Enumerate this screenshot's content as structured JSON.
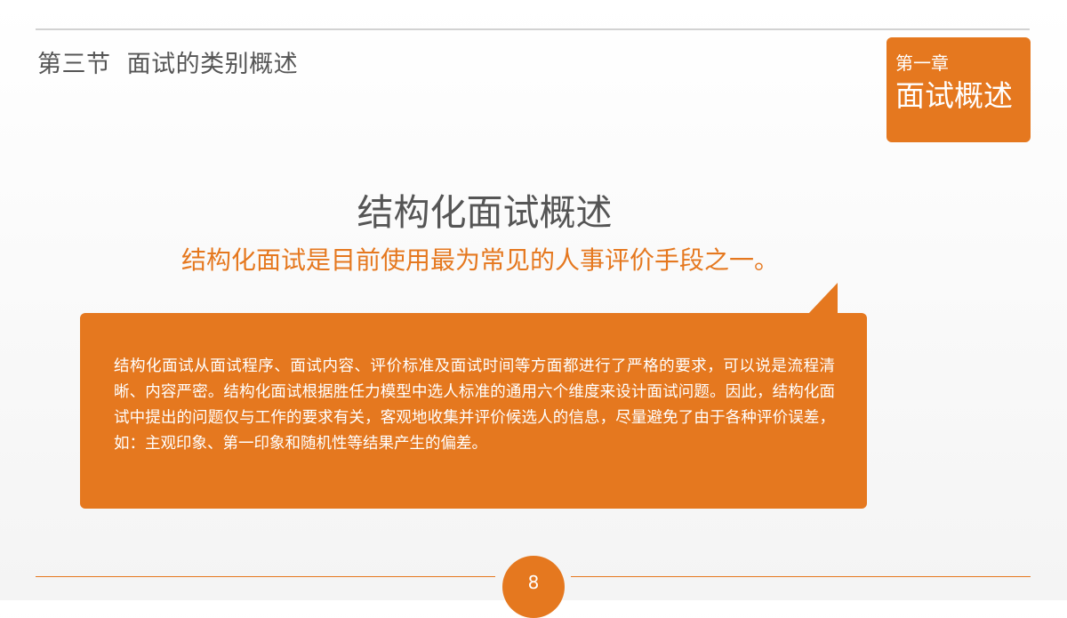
{
  "header": {
    "section_title": "第三节  面试的类别概述"
  },
  "chapter": {
    "label": "第一章",
    "name": "面试概述"
  },
  "main": {
    "title": "结构化面试概述",
    "subtitle": "结构化面试是目前使用最为常见的人事评价手段之一。",
    "body": "结构化面试从面试程序、面试内容、评价标准及面试时间等方面都进行了严格的要求，可以说是流程清晰、内容严密。结构化面试根据胜任力模型中选人标准的通用六个维度来设计面试问题。因此，结构化面试中提出的问题仅与工作的要求有关，客观地收集并评价候选人的信息，尽量避免了由于各种评价误差，如：主观印象、第一印象和随机性等结果产生的偏差。"
  },
  "footer": {
    "page_number": "8"
  },
  "colors": {
    "accent": "#e5781f",
    "text_gray": "#555555",
    "rule_gray": "#d2d2d2"
  }
}
